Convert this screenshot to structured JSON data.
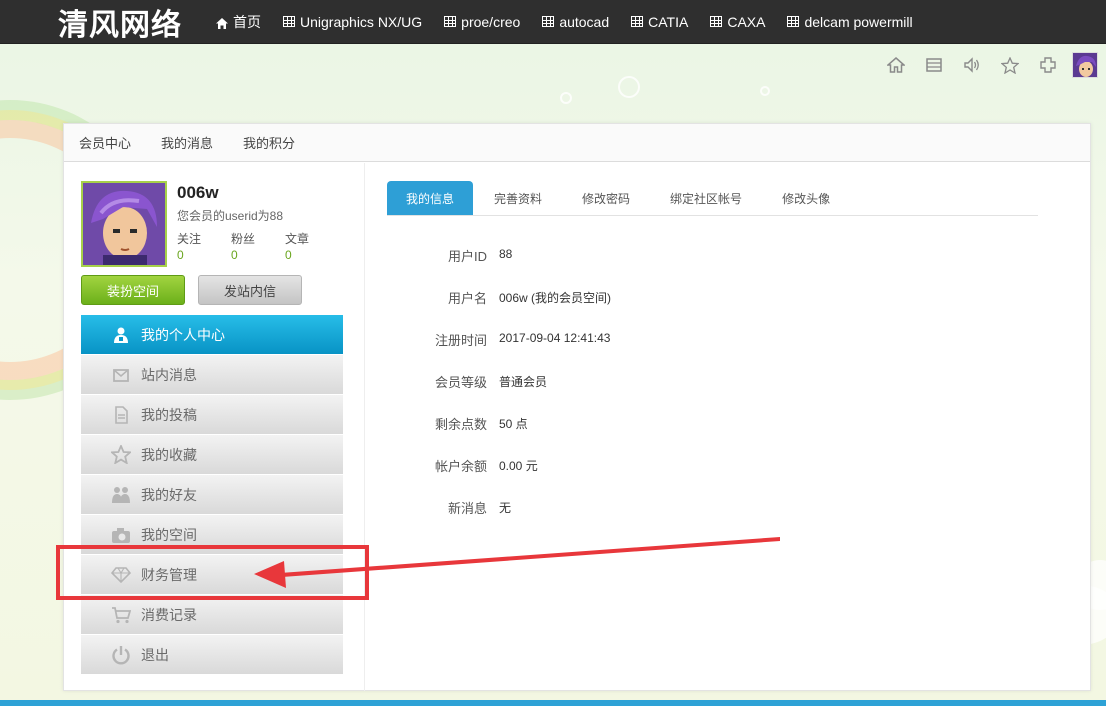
{
  "site": {
    "logo": "清风网络"
  },
  "nav": [
    {
      "label": "首页",
      "icon": "home-icon"
    },
    {
      "label": "Unigraphics NX/UG",
      "icon": "grid-icon"
    },
    {
      "label": "proe/creo",
      "icon": "grid-icon"
    },
    {
      "label": "autocad",
      "icon": "grid-icon"
    },
    {
      "label": "CATIA",
      "icon": "grid-icon"
    },
    {
      "label": "CAXA",
      "icon": "grid-icon"
    },
    {
      "label": "delcam powermill",
      "icon": "grid-icon"
    }
  ],
  "toolbar_icons": [
    "home-icon",
    "mail-icon",
    "speaker-icon",
    "star-icon",
    "puzzle-icon",
    "avatar"
  ],
  "subnav": [
    "会员中心",
    "我的消息",
    "我的积分"
  ],
  "profile": {
    "name": "006w",
    "userid_text": "您会员的userid为88",
    "stats": [
      {
        "label": "关注",
        "value": "0"
      },
      {
        "label": "粉丝",
        "value": "0"
      },
      {
        "label": "文章",
        "value": "0"
      }
    ],
    "btn_decorate": "装扮空间",
    "btn_message": "发站内信"
  },
  "menu": [
    {
      "label": "我的个人中心",
      "icon": "user-group-icon",
      "active": true
    },
    {
      "label": "站内消息",
      "icon": "message-icon"
    },
    {
      "label": "我的投稿",
      "icon": "document-icon"
    },
    {
      "label": "我的收藏",
      "icon": "star-icon"
    },
    {
      "label": "我的好友",
      "icon": "friends-icon"
    },
    {
      "label": "我的空间",
      "icon": "camera-icon"
    },
    {
      "label": "财务管理",
      "icon": "diamond-icon"
    },
    {
      "label": "消费记录",
      "icon": "cart-icon"
    },
    {
      "label": "退出",
      "icon": "power-icon"
    }
  ],
  "tabs": [
    "我的信息",
    "完善资料",
    "修改密码",
    "绑定社区帐号",
    "修改头像"
  ],
  "info": [
    {
      "label": "用户ID",
      "value": "88"
    },
    {
      "label": "用户名",
      "value": "006w (我的会员空间)"
    },
    {
      "label": "注册时间",
      "value": "2017-09-04 12:41:43"
    },
    {
      "label": "会员等级",
      "value": "普通会员"
    },
    {
      "label": "剩余点数",
      "value": "50 点"
    },
    {
      "label": "帐户余额",
      "value": "0.00 元"
    },
    {
      "label": "新消息",
      "value": "无"
    }
  ],
  "colors": {
    "accent": "#2e9fd6",
    "menu_active": "#0fa5d6",
    "green": "#6bb01a",
    "annotation": "#e8373b"
  }
}
